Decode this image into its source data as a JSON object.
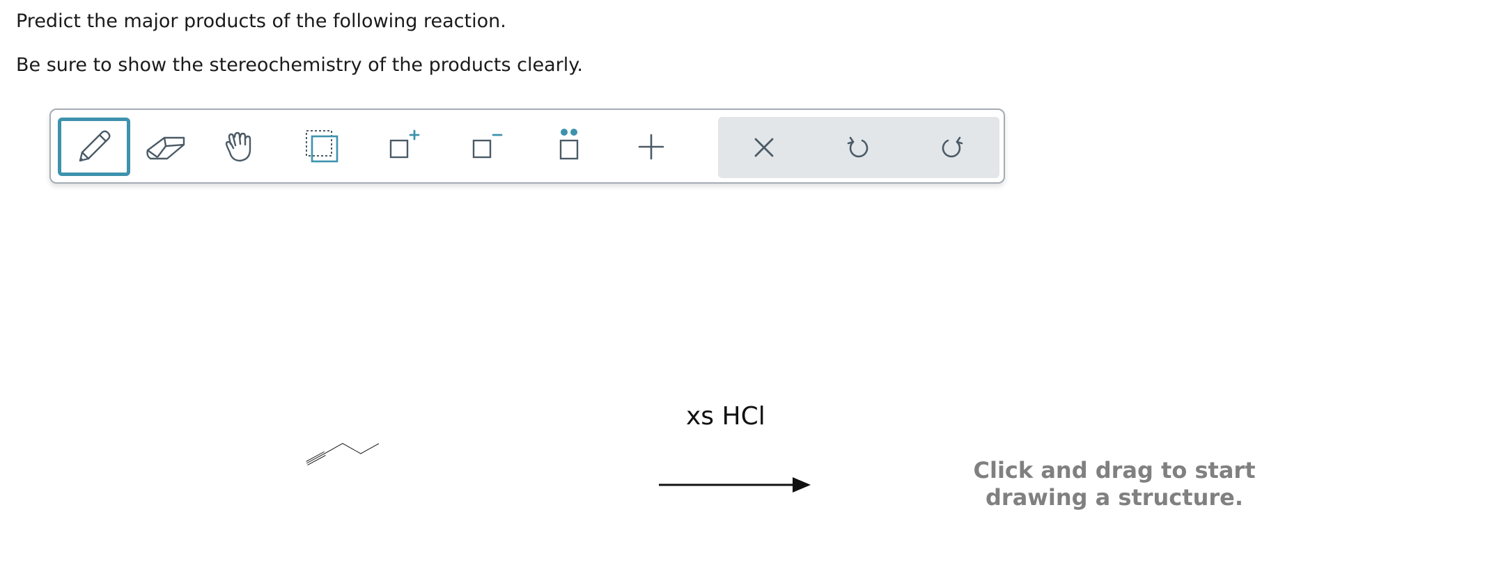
{
  "question": {
    "line1": "Predict the major products of the following reaction.",
    "line2": "Be sure to show the stereochemistry of the products clearly."
  },
  "toolbar": {
    "tools": [
      {
        "name": "pencil",
        "icon": "pencil-icon",
        "selected": true
      },
      {
        "name": "eraser",
        "icon": "eraser-icon",
        "selected": false
      },
      {
        "name": "move",
        "icon": "hand-icon",
        "selected": false
      },
      {
        "name": "select",
        "icon": "selection-icon",
        "selected": false
      },
      {
        "name": "increase-charge",
        "icon": "charge-plus-icon",
        "selected": false
      },
      {
        "name": "decrease-charge",
        "icon": "charge-minus-icon",
        "selected": false
      },
      {
        "name": "lone-pair",
        "icon": "lone-pair-icon",
        "selected": false
      },
      {
        "name": "add",
        "icon": "plus-icon",
        "selected": false
      }
    ],
    "actions": [
      {
        "name": "clear",
        "icon": "close-icon"
      },
      {
        "name": "undo",
        "icon": "undo-icon"
      },
      {
        "name": "redo",
        "icon": "redo-icon"
      }
    ],
    "accent_color": "#3d92ad",
    "icon_color": "#4a5a66"
  },
  "reaction": {
    "reagent": "xs HCl",
    "hint_line1": "Click and drag to start",
    "hint_line2": "drawing a structure."
  }
}
